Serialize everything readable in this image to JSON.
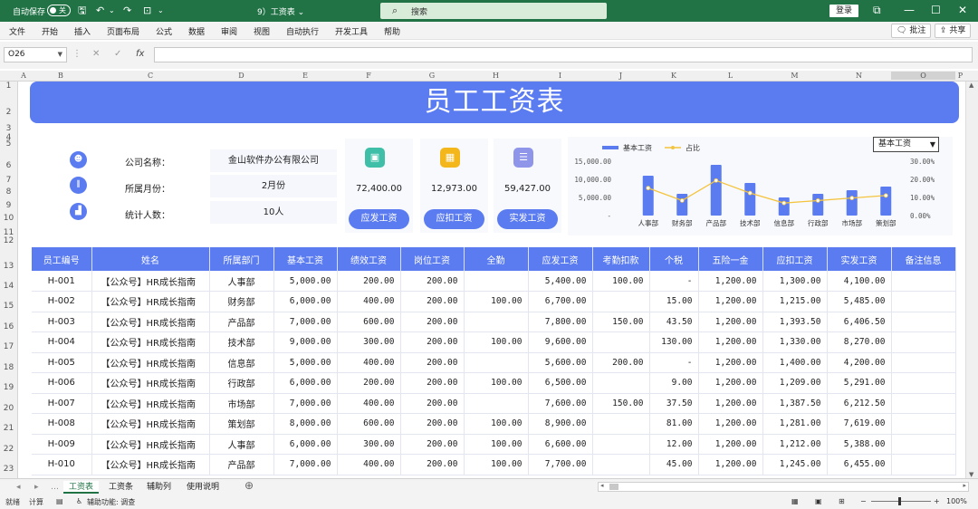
{
  "titlebar": {
    "autosave_label": "自动保存",
    "autosave_state": "关",
    "doc_title": "9）工资表 ⌄",
    "search_placeholder": "搜索",
    "login_label": "登录"
  },
  "ribbon": {
    "menus": [
      "文件",
      "开始",
      "插入",
      "页面布局",
      "公式",
      "数据",
      "审阅",
      "视图",
      "自动执行",
      "开发工具",
      "帮助"
    ],
    "comments_label": "批注",
    "share_label": "共享"
  },
  "formula_bar": {
    "name_box": "O26",
    "formula": ""
  },
  "columns": [
    "A",
    "B",
    "C",
    "D",
    "E",
    "F",
    "G",
    "H",
    "I",
    "J",
    "K",
    "L",
    "M",
    "N",
    "O",
    "P"
  ],
  "rows": [
    "1",
    "2",
    "3",
    "4",
    "5",
    "6",
    "7",
    "8",
    "9",
    "10",
    "11",
    "12",
    "13",
    "14",
    "15",
    "16",
    "17",
    "18",
    "19",
    "20",
    "21",
    "22",
    "23"
  ],
  "banner_title": "员工工资表",
  "info": {
    "company_label": "公司名称：",
    "company_value": "金山软件办公有限公司",
    "month_label": "所属月份：",
    "month_value": "2月份",
    "count_label": "统计人数：",
    "count_value": "10人"
  },
  "cards": [
    {
      "value": "72,400.00",
      "button": "应发工资",
      "color": "#3fbfa8"
    },
    {
      "value": "12,973.00",
      "button": "应扣工资",
      "color": "#f3b61b"
    },
    {
      "value": "59,427.00",
      "button": "实发工资",
      "color": "#8f95e8"
    }
  ],
  "chart_data": {
    "type": "bar",
    "categories": [
      "人事部",
      "财务部",
      "产品部",
      "技术部",
      "信息部",
      "行政部",
      "市场部",
      "策划部"
    ],
    "series": [
      {
        "name": "基本工资",
        "type": "bar",
        "axis": "left",
        "values": [
          11000,
          6000,
          14000,
          9000,
          5000,
          6000,
          7000,
          8000
        ]
      },
      {
        "name": "占比",
        "type": "line",
        "axis": "right",
        "values": [
          0.1519,
          0.0829,
          0.1934,
          0.1243,
          0.0691,
          0.0829,
          0.0967,
          0.1105
        ]
      }
    ],
    "left_axis": {
      "ticks": [
        "15,000.00",
        "10,000.00",
        "5,000.00",
        "-"
      ],
      "ylim": [
        0,
        15000
      ]
    },
    "right_axis": {
      "ticks": [
        "30.00%",
        "20.00%",
        "10.00%",
        "0.00%"
      ],
      "ylim": [
        0,
        0.3
      ]
    },
    "legend_position": "top",
    "grid": false,
    "selector_value": "基本工资"
  },
  "table": {
    "headers": [
      "员工编号",
      "姓名",
      "所属部门",
      "基本工资",
      "绩效工资",
      "岗位工资",
      "全勤",
      "应发工资",
      "考勤扣款",
      "个税",
      "五险一金",
      "应扣工资",
      "实发工资",
      "备注信息"
    ],
    "rows": [
      [
        "H-001",
        "【公众号】HR成长指南",
        "人事部",
        "5,000.00",
        "200.00",
        "200.00",
        "",
        "5,400.00",
        "100.00",
        "-",
        "1,200.00",
        "1,300.00",
        "4,100.00",
        ""
      ],
      [
        "H-002",
        "【公众号】HR成长指南",
        "财务部",
        "6,000.00",
        "400.00",
        "200.00",
        "100.00",
        "6,700.00",
        "",
        "15.00",
        "1,200.00",
        "1,215.00",
        "5,485.00",
        ""
      ],
      [
        "H-003",
        "【公众号】HR成长指南",
        "产品部",
        "7,000.00",
        "600.00",
        "200.00",
        "",
        "7,800.00",
        "150.00",
        "43.50",
        "1,200.00",
        "1,393.50",
        "6,406.50",
        ""
      ],
      [
        "H-004",
        "【公众号】HR成长指南",
        "技术部",
        "9,000.00",
        "300.00",
        "200.00",
        "100.00",
        "9,600.00",
        "",
        "130.00",
        "1,200.00",
        "1,330.00",
        "8,270.00",
        ""
      ],
      [
        "H-005",
        "【公众号】HR成长指南",
        "信息部",
        "5,000.00",
        "400.00",
        "200.00",
        "",
        "5,600.00",
        "200.00",
        "-",
        "1,200.00",
        "1,400.00",
        "4,200.00",
        ""
      ],
      [
        "H-006",
        "【公众号】HR成长指南",
        "行政部",
        "6,000.00",
        "200.00",
        "200.00",
        "100.00",
        "6,500.00",
        "",
        "9.00",
        "1,200.00",
        "1,209.00",
        "5,291.00",
        ""
      ],
      [
        "H-007",
        "【公众号】HR成长指南",
        "市场部",
        "7,000.00",
        "400.00",
        "200.00",
        "",
        "7,600.00",
        "150.00",
        "37.50",
        "1,200.00",
        "1,387.50",
        "6,212.50",
        ""
      ],
      [
        "H-008",
        "【公众号】HR成长指南",
        "策划部",
        "8,000.00",
        "600.00",
        "200.00",
        "100.00",
        "8,900.00",
        "",
        "81.00",
        "1,200.00",
        "1,281.00",
        "7,619.00",
        ""
      ],
      [
        "H-009",
        "【公众号】HR成长指南",
        "人事部",
        "6,000.00",
        "300.00",
        "200.00",
        "100.00",
        "6,600.00",
        "",
        "12.00",
        "1,200.00",
        "1,212.00",
        "5,388.00",
        ""
      ],
      [
        "H-010",
        "【公众号】HR成长指南",
        "产品部",
        "7,000.00",
        "400.00",
        "200.00",
        "100.00",
        "7,700.00",
        "",
        "45.00",
        "1,200.00",
        "1,245.00",
        "6,455.00",
        ""
      ]
    ]
  },
  "sheet_tabs": [
    "工资表",
    "工资条",
    "辅助列",
    "使用说明"
  ],
  "statusbar": {
    "ready": "就绪",
    "calc": "计算",
    "accessibility": "辅助功能: 调查",
    "zoom": "100%"
  }
}
